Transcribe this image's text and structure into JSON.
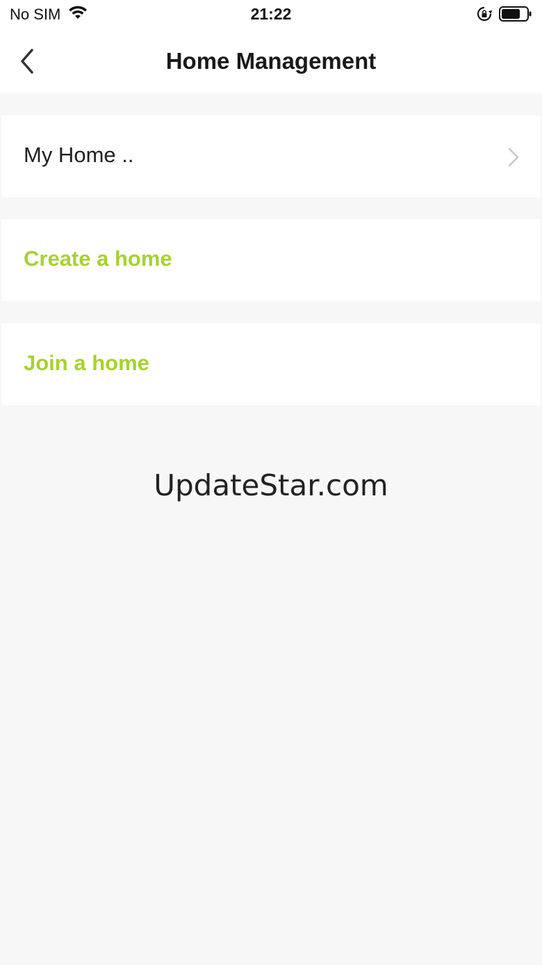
{
  "status_bar": {
    "carrier": "No SIM",
    "time": "21:22",
    "icons": [
      "wifi-icon",
      "rotation-lock-icon",
      "battery-icon"
    ]
  },
  "nav": {
    "title": "Home Management",
    "back_icon": "chevron-left-icon"
  },
  "list": {
    "home_item": "My Home ..",
    "create_label": "Create a home",
    "join_label": "Join a home"
  },
  "watermark": "UpdateStar.com",
  "colors": {
    "accent": "#a6d22f",
    "background": "#f7f7f7",
    "cell": "#ffffff"
  }
}
